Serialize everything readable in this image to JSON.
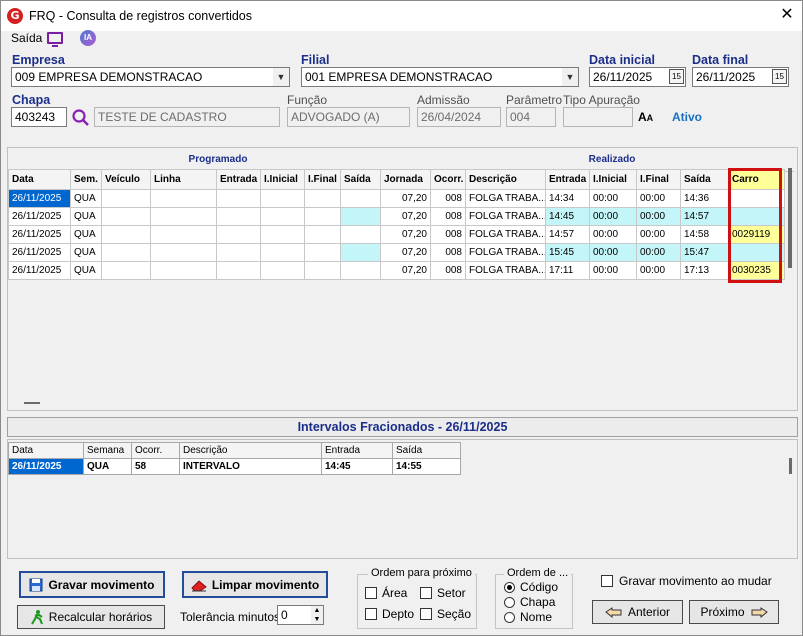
{
  "window": {
    "title": "FRQ - Consulta de registros convertidos",
    "close_glyph": "✕"
  },
  "menu": {
    "saida": "Saída",
    "ia": "IA"
  },
  "filters": {
    "empresa_label": "Empresa",
    "empresa_value": "009 EMPRESA DEMONSTRACAO",
    "filial_label": "Filial",
    "filial_value": "001 EMPRESA DEMONSTRACAO",
    "data_inicial_label": "Data inicial",
    "data_inicial_value": "26/11/2025",
    "data_final_label": "Data final",
    "data_final_value": "26/11/2025",
    "chapa_label": "Chapa",
    "chapa_value": "403243",
    "nome_value": "TESTE DE CADASTRO",
    "funcao_label": "Função",
    "funcao_value": "ADVOGADO (A)",
    "admissao_label": "Admissão",
    "admissao_value": "26/04/2024",
    "parametro_label": "Parâmetro",
    "parametro_value": "004",
    "tipo_apuracao_label": "Tipo Apuração",
    "tipo_apuracao_value": "",
    "status": "Ativo"
  },
  "grid": {
    "programado_title": "Programado",
    "realizado_title": "Realizado",
    "columns": [
      "Data",
      "Sem.",
      "Veículo",
      "Linha",
      "Entrada",
      "I.Inicial",
      "I.Final",
      "Saída",
      "Jornada",
      "Ocorr.",
      "Descrição",
      "Entrada",
      "I.Inicial",
      "I.Final",
      "Saída",
      "Carro"
    ],
    "rows": [
      [
        "26/11/2025",
        "QUA",
        "",
        "",
        "",
        "",
        "",
        "",
        "07,20",
        "008",
        "FOLGA TRABA...",
        "14:34",
        "00:00",
        "00:00",
        "14:36",
        ""
      ],
      [
        "26/11/2025",
        "QUA",
        "",
        "",
        "",
        "",
        "",
        "",
        "07,20",
        "008",
        "FOLGA TRABA...",
        "14:45",
        "00:00",
        "00:00",
        "14:57",
        ""
      ],
      [
        "26/11/2025",
        "QUA",
        "",
        "",
        "",
        "",
        "",
        "",
        "07,20",
        "008",
        "FOLGA TRABA...",
        "14:57",
        "00:00",
        "00:00",
        "14:58",
        "0029119"
      ],
      [
        "26/11/2025",
        "QUA",
        "",
        "",
        "",
        "",
        "",
        "",
        "07,20",
        "008",
        "FOLGA TRABA...",
        "15:45",
        "00:00",
        "00:00",
        "15:47",
        ""
      ],
      [
        "26/11/2025",
        "QUA",
        "",
        "",
        "",
        "",
        "",
        "",
        "07,20",
        "008",
        "FOLGA TRABA...",
        "17:11",
        "00:00",
        "00:00",
        "17:13",
        "0030235"
      ]
    ]
  },
  "intervalos": {
    "title": "Intervalos Fracionados - 26/11/2025",
    "columns": [
      "Data",
      "Semana",
      "Ocorr.",
      "Descrição",
      "Entrada",
      "Saída"
    ],
    "rows": [
      [
        "26/11/2025",
        "QUA",
        "58",
        "INTERVALO",
        "14:45",
        "14:55"
      ]
    ]
  },
  "footer": {
    "gravar": "Gravar movimento",
    "limpar": "Limpar movimento",
    "recalcular": "Recalcular horários",
    "tolerancia_label": "Tolerância minutos",
    "tolerancia_value": "0",
    "ordem_proximo_title": "Ordem para próximo",
    "area": "Área",
    "setor": "Setor",
    "depto": "Depto",
    "secao": "Seção",
    "ordem_de_title": "Ordem de ...",
    "codigo": "Código",
    "chapa": "Chapa",
    "nome": "Nome",
    "gravar_ao_mudar": "Gravar movimento ao mudar",
    "anterior": "Anterior",
    "proximo": "Próximo"
  },
  "colors": {
    "accent_blue": "#1b2e8a",
    "highlight_cyan": "#c4f5f8",
    "highlight_yellow": "#ffff99",
    "selection": "#0066d0",
    "alert_red": "#d01010"
  }
}
